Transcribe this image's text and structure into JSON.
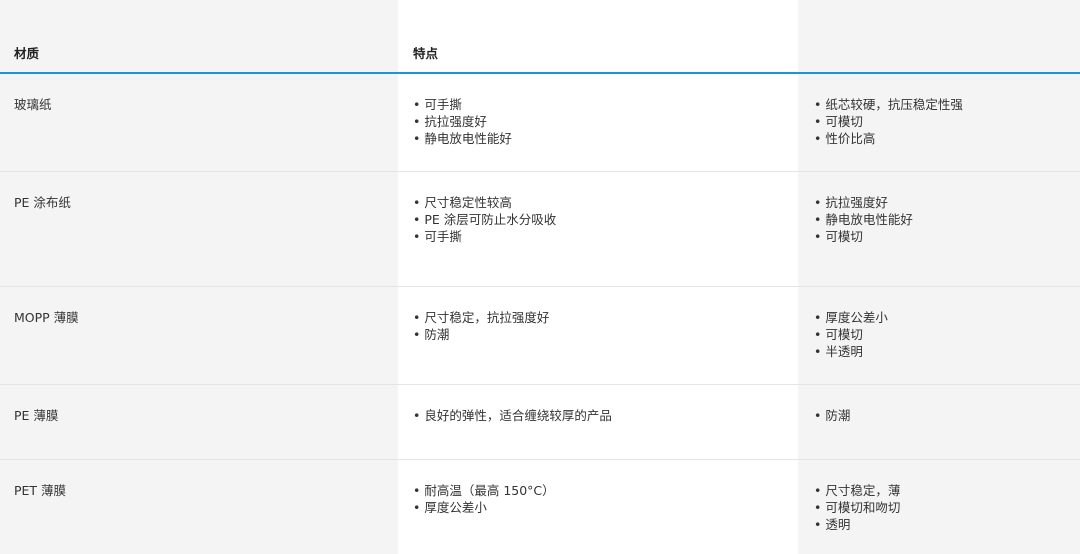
{
  "header": {
    "col1": "材质",
    "col2": "特点",
    "col3": ""
  },
  "rows": [
    {
      "material": "玻璃纸",
      "features": [
        "• 可手撕",
        "• 抗拉强度好",
        "• 静电放电性能好"
      ],
      "extra": [
        "• 纸芯较硬，抗压稳定性强",
        "• 可模切",
        "• 性价比高"
      ]
    },
    {
      "material": "PE 涂布纸",
      "features": [
        "• 尺寸稳定性较高",
        "• PE 涂层可防止水分吸收",
        "• 可手撕"
      ],
      "extra": [
        "• 抗拉强度好",
        "• 静电放电性能好",
        "• 可模切"
      ]
    },
    {
      "material": "MOPP 薄膜",
      "features": [
        "• 尺寸稳定，抗拉强度好",
        "• 防潮"
      ],
      "extra": [
        "• 厚度公差小",
        "• 可模切",
        "• 半透明"
      ]
    },
    {
      "material": "PE 薄膜",
      "features": [
        "• 良好的弹性，适合缠绕较厚的产品"
      ],
      "extra": [
        "• 防潮"
      ]
    },
    {
      "material": "PET 薄膜",
      "features": [
        "• 耐高温（最高 150°C）",
        "• 厚度公差小"
      ],
      "extra": [
        "• 尺寸稳定，薄",
        "• 可模切和吻切",
        "• 透明"
      ]
    }
  ],
  "colors": {
    "header_rule": "#1b95d4",
    "shaded_column": "#f4f4f4",
    "text": "#333333"
  }
}
